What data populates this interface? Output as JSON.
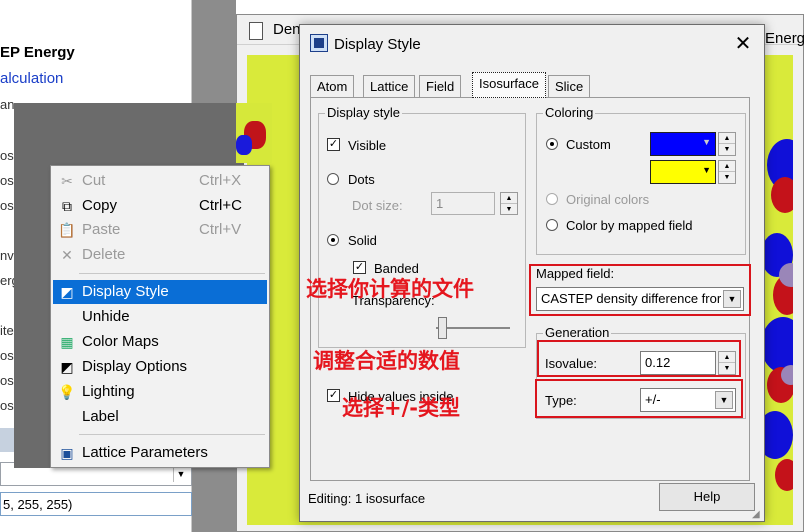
{
  "left_panel": {
    "tree": [
      {
        "text": "EP Energy",
        "style": "bold"
      },
      {
        "text": "alculation",
        "style": "link"
      },
      {
        "text": "an",
        "style": "plain"
      },
      {
        "text": "os",
        "style": "plain"
      },
      {
        "text": "os",
        "style": "plain"
      },
      {
        "text": "os",
        "style": "plain"
      },
      {
        "text": "nv",
        "style": "plain"
      },
      {
        "text": "erg",
        "style": "plain"
      },
      {
        "text": "ite",
        "style": "plain"
      },
      {
        "text": "os",
        "style": "plain"
      },
      {
        "text": "os",
        "style": "plain"
      },
      {
        "text": "os",
        "style": "plain"
      },
      {
        "text": "os",
        "style": "plain"
      }
    ],
    "value_box": "5, 255, 255)"
  },
  "doc_window": {
    "title": "Den",
    "title_right": "Energ"
  },
  "context_menu": {
    "items": [
      {
        "label": "Cut",
        "accel": "Ctrl+X",
        "icon": "scissors-icon",
        "glyph": "✂",
        "disabled": true
      },
      {
        "label": "Copy",
        "accel": "Ctrl+C",
        "icon": "copy-icon",
        "glyph": "⧉",
        "disabled": false
      },
      {
        "label": "Paste",
        "accel": "Ctrl+V",
        "icon": "paste-icon",
        "glyph": "📋",
        "disabled": true
      },
      {
        "label": "Delete",
        "accel": "",
        "icon": "delete-icon",
        "glyph": "✕",
        "disabled": true
      },
      {
        "label": "Display Style",
        "accel": "",
        "icon": "display-style-icon",
        "glyph": "◩",
        "disabled": false,
        "selected": true
      },
      {
        "label": "Unhide",
        "accel": "",
        "icon": "",
        "glyph": "",
        "disabled": false
      },
      {
        "label": "Color Maps",
        "accel": "",
        "icon": "color-maps-icon",
        "glyph": "▦",
        "disabled": false
      },
      {
        "label": "Display Options",
        "accel": "",
        "icon": "display-options-icon",
        "glyph": "◩",
        "disabled": false
      },
      {
        "label": "Lighting",
        "accel": "",
        "icon": "lightbulb-icon",
        "glyph": "💡",
        "disabled": false
      },
      {
        "label": "Label",
        "accel": "",
        "icon": "",
        "glyph": "",
        "disabled": false
      },
      {
        "label": "Lattice Parameters",
        "accel": "",
        "icon": "lattice-icon",
        "glyph": "▣",
        "disabled": false
      }
    ]
  },
  "dialog": {
    "title": "Display Style",
    "close_glyph": "✕",
    "tabs": [
      "Atom",
      "Lattice",
      "Field",
      "Isosurface",
      "Slice"
    ],
    "active_tab": "Isosurface",
    "display_style": {
      "group_label": "Display style",
      "visible_label": "Visible",
      "visible_checked": true,
      "dots_label": "Dots",
      "dot_size_label": "Dot size:",
      "dot_size_value": "1",
      "solid_label": "Solid",
      "banded_label": "Banded",
      "banded_checked": true,
      "transparency_label": "Transparency:",
      "transparency_value": 0.05
    },
    "hide_values_label": "Hide values inside",
    "hide_values_checked": true,
    "coloring": {
      "group_label": "Coloring",
      "custom_label": "Custom",
      "custom_selected": true,
      "color1": "#0000ff",
      "color2": "#ffff00",
      "original_colors_label": "Original colors",
      "mapped_field_radio_label": "Color by mapped field"
    },
    "mapped_field": {
      "label": "Mapped field:",
      "value": "CASTEP density difference fror"
    },
    "generation": {
      "group_label": "Generation",
      "isovalue_label": "Isovalue:",
      "isovalue": "0.12",
      "type_label": "Type:",
      "type_value": "+/-"
    },
    "status_text": "Editing: 1 isosurface",
    "help_label": "Help"
  },
  "annotations": {
    "select_file": "选择你计算的文件",
    "adjust_value": "调整合适的数值",
    "select_type": "选择+/-类型",
    "color": "#e5161e"
  }
}
